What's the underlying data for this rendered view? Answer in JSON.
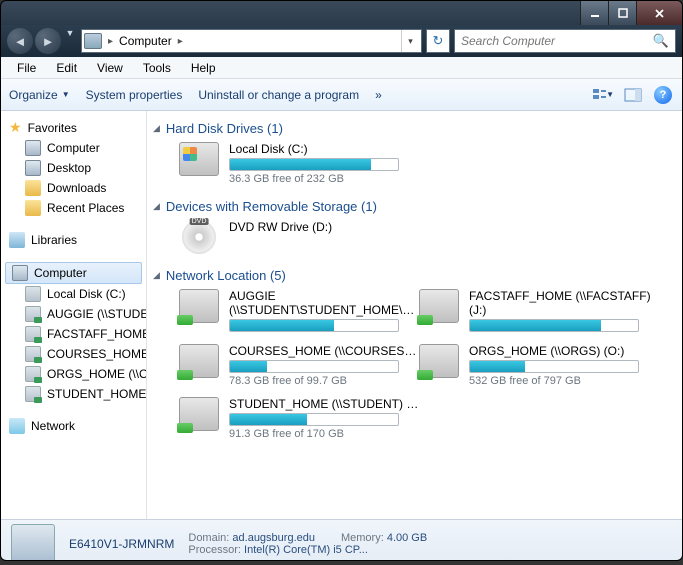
{
  "titlebar": {},
  "nav": {
    "location_label": "Computer",
    "search_placeholder": "Search Computer"
  },
  "menu": {
    "file": "File",
    "edit": "Edit",
    "view": "View",
    "tools": "Tools",
    "help": "Help"
  },
  "toolbar": {
    "organize": "Organize",
    "system_properties": "System properties",
    "uninstall": "Uninstall or change a program",
    "more": "»"
  },
  "sidebar": {
    "favorites": {
      "label": "Favorites",
      "items": [
        "Computer",
        "Desktop",
        "Downloads",
        "Recent Places"
      ]
    },
    "libraries": {
      "label": "Libraries"
    },
    "computer": {
      "label": "Computer",
      "items": [
        "Local Disk (C:)",
        "AUGGIE (\\\\STUDENT\\STUDENT_…",
        "FACSTAFF_HOME (\\\\FACST…",
        "COURSES_HOME (\\\\COUR…",
        "ORGS_HOME (\\\\ORGS) (…",
        "STUDENT_HOME (\\\\STU…"
      ]
    },
    "network": {
      "label": "Network"
    }
  },
  "content": {
    "hdd": {
      "header": "Hard Disk Drives (1)",
      "items": [
        {
          "label": "Local Disk (C:)",
          "free": "36.3 GB free of 232 GB",
          "fill": 84
        }
      ]
    },
    "removable": {
      "header": "Devices with Removable Storage (1)",
      "items": [
        {
          "label": "DVD RW Drive (D:)"
        }
      ]
    },
    "network": {
      "header": "Network Location (5)",
      "items": [
        {
          "label": "AUGGIE",
          "label2": "(\\\\STUDENT\\STUDENT_HOME\\A...",
          "free": "",
          "fill": 62
        },
        {
          "label": "FACSTAFF_HOME (\\\\FACSTAFF)",
          "label2": "(J:)",
          "free": "",
          "fill": 78
        },
        {
          "label": "COURSES_HOME (\\\\COURSES) (K:)",
          "label2": "",
          "free": "78.3 GB free of 99.7 GB",
          "fill": 22
        },
        {
          "label": "ORGS_HOME (\\\\ORGS) (O:)",
          "label2": "",
          "free": "532 GB free of 797 GB",
          "fill": 33
        },
        {
          "label": "STUDENT_HOME (\\\\STUDENT) (S:)",
          "label2": "",
          "free": "91.3 GB free of 170 GB",
          "fill": 46
        }
      ]
    }
  },
  "status": {
    "name": "E6410V1-JRMNRM",
    "domain_label": "Domain:",
    "domain": "ad.augsburg.edu",
    "memory_label": "Memory:",
    "memory": "4.00 GB",
    "processor_label": "Processor:",
    "processor": "Intel(R) Core(TM) i5 CP..."
  }
}
